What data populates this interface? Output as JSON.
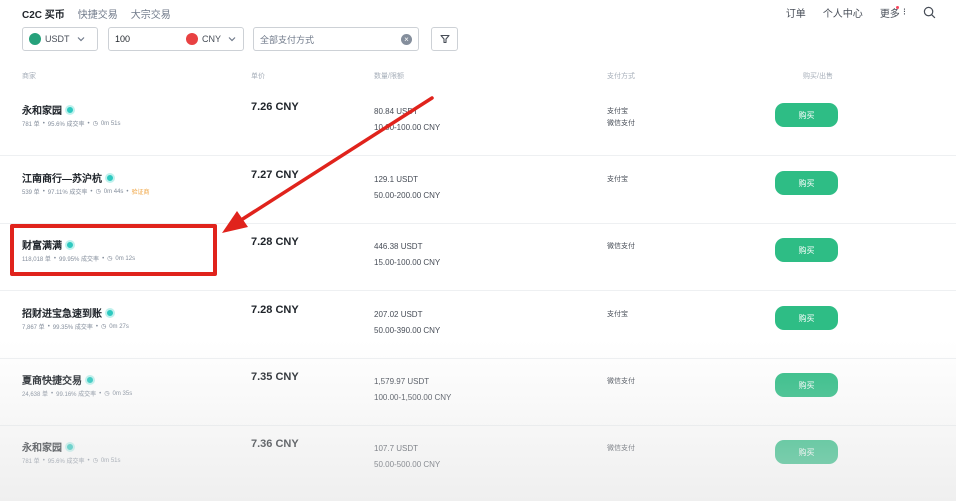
{
  "nav": {
    "brand": "C2C 买币",
    "tabs": [
      "快捷交易",
      "大宗交易"
    ],
    "right": {
      "orders": "订单",
      "profile": "个人中心",
      "more": "更多",
      "more_kebab": "⁝"
    }
  },
  "filters": {
    "coin": "USDT",
    "amount": "100",
    "fiat": "CNY",
    "payment_placeholder": "全部支付方式"
  },
  "columns": {
    "merchant": "商家",
    "price": "单价",
    "limits": "数量/限额",
    "payment": "支付方式",
    "action": "购买/出售"
  },
  "rows": [
    {
      "name": "永和家园",
      "orders": "781 单",
      "completion": "95.6% 成交率",
      "time": "0m 51s",
      "tag": "",
      "price": "7.26 CNY",
      "available": "80.84 USDT",
      "limit": "10.00-100.00 CNY",
      "payments": [
        "支付宝",
        "微信支付"
      ],
      "button": "购买"
    },
    {
      "name": "江南商行—苏沪杭",
      "orders": "539 单",
      "completion": "97.11% 成交率",
      "time": "0m 44s",
      "tag": "验证商",
      "price": "7.27 CNY",
      "available": "129.1 USDT",
      "limit": "50.00-200.00 CNY",
      "payments": [
        "支付宝"
      ],
      "button": "购买"
    },
    {
      "name": "财富满满",
      "orders": "118,018 单",
      "completion": "99.95% 成交率",
      "time": "0m 12s",
      "tag": "",
      "price": "7.28 CNY",
      "available": "446.38 USDT",
      "limit": "15.00-100.00 CNY",
      "payments": [
        "微信支付"
      ],
      "button": "购买"
    },
    {
      "name": "招财进宝急速到账",
      "orders": "7,867 单",
      "completion": "99.35% 成交率",
      "time": "0m 27s",
      "tag": "",
      "price": "7.28 CNY",
      "available": "207.02 USDT",
      "limit": "50.00-390.00 CNY",
      "payments": [
        "支付宝"
      ],
      "button": "购买"
    },
    {
      "name": "夏商快捷交易",
      "orders": "24,638 单",
      "completion": "99.16% 成交率",
      "time": "0m 35s",
      "tag": "",
      "price": "7.35 CNY",
      "available": "1,579.97 USDT",
      "limit": "100.00-1,500.00 CNY",
      "payments": [
        "微信支付"
      ],
      "button": "购买"
    },
    {
      "name": "永和家园",
      "orders": "781 单",
      "completion": "95.6% 成交率",
      "time": "0m 51s",
      "tag": "",
      "price": "7.36 CNY",
      "available": "107.7 USDT",
      "limit": "50.00-500.00 CNY",
      "payments": [
        "微信支付"
      ],
      "button": "购买"
    }
  ],
  "colors": {
    "buy_green": "#2ebd85",
    "verify_teal": "#2ec9c0",
    "highlight_red": "#e0231c",
    "usdt_green": "#26a17b",
    "cny_red": "#e84142"
  },
  "icons": [
    "search-icon",
    "usdt-coin-icon",
    "cny-coin-icon",
    "chevron-down-icon",
    "clear-icon",
    "filter-icon",
    "verified-icon",
    "clock-icon"
  ]
}
